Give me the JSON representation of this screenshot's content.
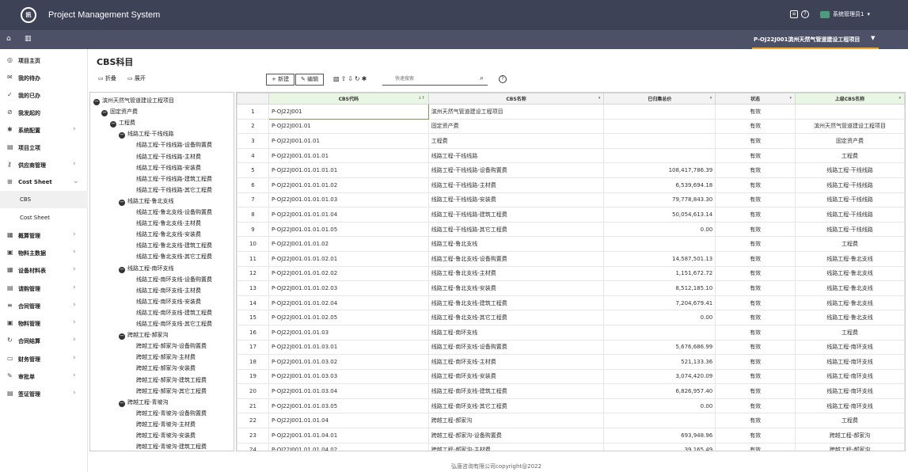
{
  "header": {
    "logo_text": "訊",
    "app_title": "Project Management System",
    "user_name": "系统管理员1"
  },
  "navbar": {
    "project_tab": "P-OJ22J001滨州天然气管道建设工程项目"
  },
  "sidebar": {
    "items": [
      {
        "label": "项目主页",
        "icon": "location-icon"
      },
      {
        "label": "我的待办",
        "icon": "mail-icon"
      },
      {
        "label": "我的已办",
        "icon": "check-circle-icon"
      },
      {
        "label": "我发起的",
        "icon": "send-icon"
      },
      {
        "label": "系统配置",
        "icon": "gear-icon"
      },
      {
        "label": "项目立项",
        "icon": "doc-icon"
      },
      {
        "label": "供应商管理",
        "icon": "key-icon"
      },
      {
        "label": "Cost Sheet",
        "icon": "cart-icon"
      },
      {
        "label": "CBS",
        "icon": ""
      },
      {
        "label": "Cost Sheet",
        "icon": ""
      },
      {
        "label": "概算管理",
        "icon": "calc-icon"
      },
      {
        "label": "物料主数据",
        "icon": "box-icon"
      },
      {
        "label": "设备材料表",
        "icon": "table-icon"
      },
      {
        "label": "请购管理",
        "icon": "doc-icon"
      },
      {
        "label": "合同管理",
        "icon": "contract-icon"
      },
      {
        "label": "物料管理",
        "icon": "box-icon"
      },
      {
        "label": "合同结算",
        "icon": "refresh-icon"
      },
      {
        "label": "财务管理",
        "icon": "wallet-icon"
      },
      {
        "label": "审批单",
        "icon": "pen-icon"
      },
      {
        "label": "签证管理",
        "icon": "doc-icon"
      }
    ]
  },
  "main": {
    "title": "CBS科目",
    "collapse_label": "折叠",
    "expand_label": "展开",
    "new_label": "+ 新建",
    "edit_label": "✎ 编辑",
    "search_placeholder": "快速搜索"
  },
  "tree": [
    {
      "label": "滨州天然气管道建设工程项目",
      "level": 0,
      "toggle": true
    },
    {
      "label": "固定资产费",
      "level": 1,
      "toggle": true
    },
    {
      "label": "工程费",
      "level": 2,
      "toggle": true
    },
    {
      "label": "线路工程-干线线路",
      "level": 3,
      "toggle": true
    },
    {
      "label": "线路工程-干线线路-设备购置费",
      "level": 4
    },
    {
      "label": "线路工程-干线线路-主材费",
      "level": 4
    },
    {
      "label": "线路工程-干线线路-安装费",
      "level": 4
    },
    {
      "label": "线路工程-干线线路-建筑工程费",
      "level": 4
    },
    {
      "label": "线路工程-干线线路-其它工程费",
      "level": 4
    },
    {
      "label": "线路工程-鲁北支线",
      "level": 3,
      "toggle": true
    },
    {
      "label": "线路工程-鲁北支线-设备购置费",
      "level": 4
    },
    {
      "label": "线路工程-鲁北支线-主材费",
      "level": 4
    },
    {
      "label": "线路工程-鲁北支线-安装费",
      "level": 4
    },
    {
      "label": "线路工程-鲁北支线-建筑工程费",
      "level": 4
    },
    {
      "label": "线路工程-鲁北支线-其它工程费",
      "level": 4
    },
    {
      "label": "线路工程-南环支线",
      "level": 3,
      "toggle": true
    },
    {
      "label": "线路工程-南环支线-设备购置费",
      "level": 4
    },
    {
      "label": "线路工程-南环支线-主材费",
      "level": 4
    },
    {
      "label": "线路工程-南环支线-安装费",
      "level": 4
    },
    {
      "label": "线路工程-南环支线-建筑工程费",
      "level": 4
    },
    {
      "label": "线路工程-南环支线-其它工程费",
      "level": 4
    },
    {
      "label": "跨越工程-郝家沟",
      "level": 3,
      "toggle": true
    },
    {
      "label": "跨越工程-郝家沟-设备购置费",
      "level": 4
    },
    {
      "label": "跨越工程-郝家沟-主材费",
      "level": 4
    },
    {
      "label": "跨越工程-郝家沟-安装费",
      "level": 4
    },
    {
      "label": "跨越工程-郝家沟-建筑工程费",
      "level": 4
    },
    {
      "label": "跨越工程-郝家沟-其它工程费",
      "level": 4
    },
    {
      "label": "跨越工程-青坡沟",
      "level": 3,
      "toggle": true
    },
    {
      "label": "跨越工程-青坡沟-设备购置费",
      "level": 4
    },
    {
      "label": "跨越工程-青坡沟-主材费",
      "level": 4
    },
    {
      "label": "跨越工程-青坡沟-安装费",
      "level": 4
    },
    {
      "label": "跨越工程-青坡沟-建筑工程费",
      "level": 4
    }
  ],
  "table": {
    "columns": [
      "CBS代码",
      "CBS名称",
      "已归集总价",
      "状态",
      "上级CBS名称"
    ],
    "rows": [
      [
        "1",
        "P-OJ22J001",
        "滨州天然气管道建设工程项目",
        "",
        "有效",
        ""
      ],
      [
        "2",
        "P-OJ22J001.01",
        "固定资产费",
        "",
        "有效",
        "滨州天然气管道建设工程项目"
      ],
      [
        "3",
        "P-OJ22J001.01.01",
        "工程费",
        "",
        "有效",
        "固定资产费"
      ],
      [
        "4",
        "P-OJ22J001.01.01.01",
        "线路工程-干线线路",
        "",
        "有效",
        "工程费"
      ],
      [
        "5",
        "P-OJ22J001.01.01.01.01",
        "线路工程-干线线路-设备购置费",
        "108,417,786.39",
        "有效",
        "线路工程-干线线路"
      ],
      [
        "6",
        "P-OJ22J001.01.01.01.02",
        "线路工程-干线线路-主材费",
        "6,539,694.18",
        "有效",
        "线路工程-干线线路"
      ],
      [
        "7",
        "P-OJ22J001.01.01.01.03",
        "线路工程-干线线路-安装费",
        "79,778,843.30",
        "有效",
        "线路工程-干线线路"
      ],
      [
        "8",
        "P-OJ22J001.01.01.01.04",
        "线路工程-干线线路-建筑工程费",
        "50,054,613.14",
        "有效",
        "线路工程-干线线路"
      ],
      [
        "9",
        "P-OJ22J001.01.01.01.05",
        "线路工程-干线线路-其它工程费",
        "0.00",
        "有效",
        "线路工程-干线线路"
      ],
      [
        "10",
        "P-OJ22J001.01.01.02",
        "线路工程-鲁北支线",
        "",
        "有效",
        "工程费"
      ],
      [
        "11",
        "P-OJ22J001.01.01.02.01",
        "线路工程-鲁北支线-设备购置费",
        "14,587,501.13",
        "有效",
        "线路工程-鲁北支线"
      ],
      [
        "12",
        "P-OJ22J001.01.01.02.02",
        "线路工程-鲁北支线-主材费",
        "1,151,672.72",
        "有效",
        "线路工程-鲁北支线"
      ],
      [
        "13",
        "P-OJ22J001.01.01.02.03",
        "线路工程-鲁北支线-安装费",
        "8,512,185.10",
        "有效",
        "线路工程-鲁北支线"
      ],
      [
        "14",
        "P-OJ22J001.01.01.02.04",
        "线路工程-鲁北支线-建筑工程费",
        "7,204,679.41",
        "有效",
        "线路工程-鲁北支线"
      ],
      [
        "15",
        "P-OJ22J001.01.01.02.05",
        "线路工程-鲁北支线-其它工程费",
        "0.00",
        "有效",
        "线路工程-鲁北支线"
      ],
      [
        "16",
        "P-OJ22J001.01.01.03",
        "线路工程-南环支线",
        "",
        "有效",
        "工程费"
      ],
      [
        "17",
        "P-OJ22J001.01.01.03.01",
        "线路工程-南环支线-设备购置费",
        "5,676,686.99",
        "有效",
        "线路工程-南环支线"
      ],
      [
        "18",
        "P-OJ22J001.01.01.03.02",
        "线路工程-南环支线-主材费",
        "521,133.36",
        "有效",
        "线路工程-南环支线"
      ],
      [
        "19",
        "P-OJ22J001.01.01.03.03",
        "线路工程-南环支线-安装费",
        "3,074,420.09",
        "有效",
        "线路工程-南环支线"
      ],
      [
        "20",
        "P-OJ22J001.01.01.03.04",
        "线路工程-南环支线-建筑工程费",
        "6,826,957.40",
        "有效",
        "线路工程-南环支线"
      ],
      [
        "21",
        "P-OJ22J001.01.01.03.05",
        "线路工程-南环支线-其它工程费",
        "0.00",
        "有效",
        "线路工程-南环支线"
      ],
      [
        "22",
        "P-OJ22J001.01.01.04",
        "跨越工程-郝家沟",
        "",
        "有效",
        "工程费"
      ],
      [
        "23",
        "P-OJ22J001.01.01.04.01",
        "跨越工程-郝家沟-设备购置费",
        "693,948.96",
        "有效",
        "跨越工程-郝家沟"
      ],
      [
        "24",
        "P-OJ22J001.01.01.04.02",
        "跨越工程-郝家沟-主材费",
        "39,165.49",
        "有效",
        "跨越工程-郝家沟"
      ]
    ]
  },
  "footer": {
    "text": "弘唐咨询有限公司copyright@2022"
  }
}
